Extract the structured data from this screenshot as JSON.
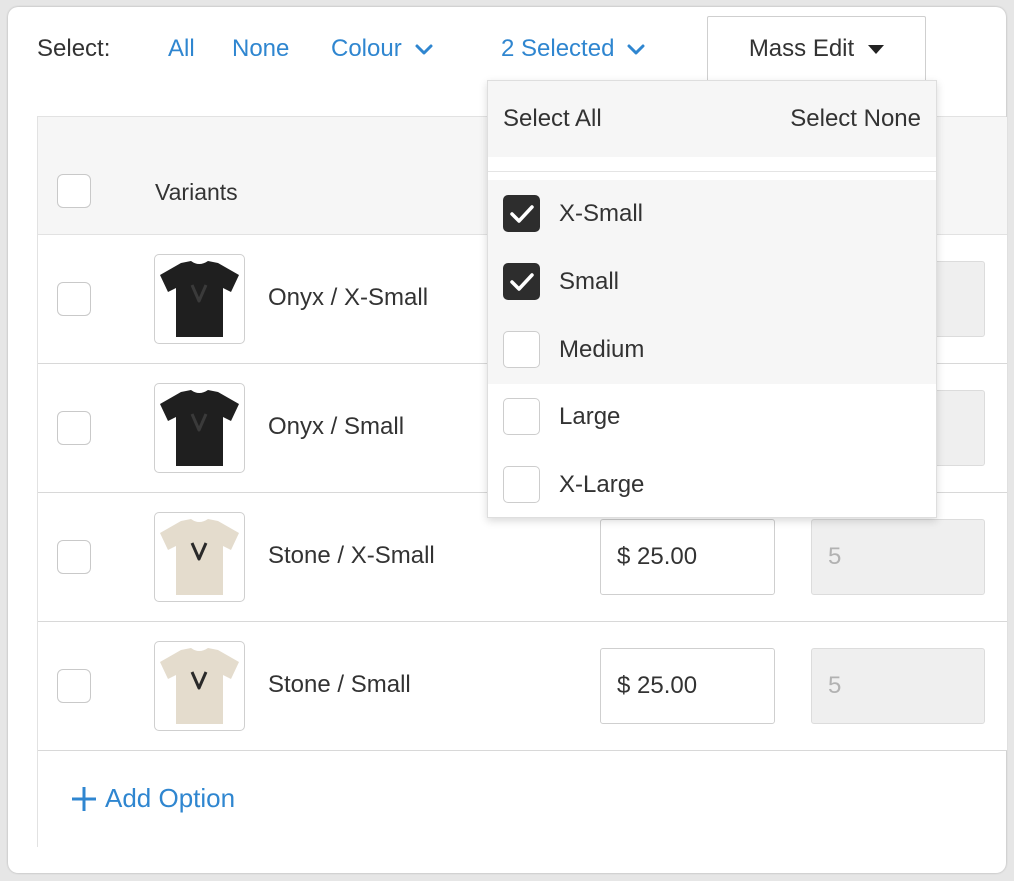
{
  "toolbar": {
    "select_label": "Select:",
    "all": "All",
    "none": "None",
    "colour": "Colour",
    "selected": "2 Selected",
    "mass_edit": "Mass Edit"
  },
  "table": {
    "header_variants": "Variants",
    "rows": [
      {
        "label": "Onyx / X-Small",
        "colour": "onyx",
        "price": "",
        "qty": ""
      },
      {
        "label": "Onyx / Small",
        "colour": "onyx",
        "price": "",
        "qty": ""
      },
      {
        "label": "Stone / X-Small",
        "colour": "stone",
        "price": "$ 25.00",
        "qty": "5"
      },
      {
        "label": "Stone / Small",
        "colour": "stone",
        "price": "$ 25.00",
        "qty": "5"
      }
    ],
    "add_option": "Add Option"
  },
  "dropdown": {
    "select_all": "Select All",
    "select_none": "Select None",
    "items": [
      {
        "label": "X-Small",
        "checked": true
      },
      {
        "label": "Small",
        "checked": true
      },
      {
        "label": "Medium",
        "checked": false
      },
      {
        "label": "Large",
        "checked": false
      },
      {
        "label": "X-Large",
        "checked": false
      }
    ]
  },
  "colors": {
    "accent": "#2f86d0",
    "onyx": "#1f1f1f",
    "stone": "#e4dccd",
    "checked": "#2d2d2d"
  }
}
